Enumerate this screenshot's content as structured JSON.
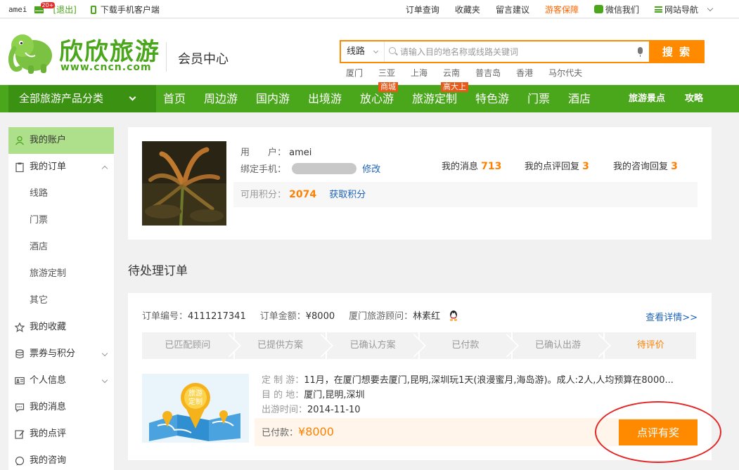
{
  "topbar": {
    "username": "amei",
    "mail_badge": "20+",
    "logout": "[退出]",
    "download": "下载手机客户端",
    "links": [
      "订单查询",
      "收藏夹",
      "留言建议",
      "游客保障",
      "微信我们",
      "网站导航"
    ]
  },
  "header": {
    "logo_title": "欣欣旅游",
    "logo_url": "www.cncn.com",
    "member_center": "会员中心",
    "search_type": "线路",
    "search_placeholder": "请输入目的地名称或线路关键词",
    "search_button": "搜 索",
    "hot_cities": [
      "厦门",
      "三亚",
      "上海",
      "云南",
      "普吉岛",
      "香港",
      "马尔代夫"
    ]
  },
  "nav": {
    "all_categories": "全部旅游产品分类",
    "items": [
      "首页",
      "周边游",
      "国内游",
      "出境游",
      "放心游",
      "旅游定制",
      "特色游",
      "门票",
      "酒店"
    ],
    "tag_mall": "商城",
    "tag_custom": "高大上",
    "right": [
      "旅游景点",
      "攻略"
    ]
  },
  "sidebar": {
    "items": [
      {
        "label": "我的账户"
      },
      {
        "label": "我的订单"
      },
      {
        "label": "线路"
      },
      {
        "label": "门票"
      },
      {
        "label": "酒店"
      },
      {
        "label": "旅游定制"
      },
      {
        "label": "其它"
      },
      {
        "label": "我的收藏"
      },
      {
        "label": "票券与积分"
      },
      {
        "label": "个人信息"
      },
      {
        "label": "我的消息"
      },
      {
        "label": "我的点评"
      },
      {
        "label": "我的咨询"
      }
    ]
  },
  "profile": {
    "user_label": "用　　户：",
    "username": "amei",
    "phone_label": "绑定手机：",
    "modify": "修改",
    "messages_label": "我的消息",
    "messages_count": "713",
    "review_replies_label": "我的点评回复",
    "review_replies_count": "3",
    "consult_replies_label": "我的咨询回复",
    "consult_replies_count": "3",
    "points_label": "可用积分：",
    "points_value": "2074",
    "get_points": "获取积分"
  },
  "pending": {
    "title": "待处理订单"
  },
  "order": {
    "number_label": "订单编号：",
    "number": "4111217341",
    "amount_label": "订单金额：",
    "amount": "¥8000",
    "advisor_label": "厦门旅游顾问：",
    "advisor": "林素红",
    "detail_link": "查看详情>>",
    "steps": [
      "已匹配顾问",
      "已提供方案",
      "已确认方案",
      "已付款",
      "已确认出游",
      "待评价"
    ],
    "custom_label": "定 制 游：",
    "custom_text": "11月，在厦门想要去厦门,昆明,深圳玩1天(浪漫蜜月,海岛游)。成人:2人,人均预算在8000...",
    "dest_label": "目 的 地：",
    "dest": "厦门,昆明,深圳",
    "date_label": "出游时间：",
    "date": "2014-11-10",
    "paid_label": "已付款：",
    "paid_amount": "¥8000",
    "review_button": "点评有奖",
    "map_badge_line1": "旅游",
    "map_badge_line2": "定制"
  }
}
